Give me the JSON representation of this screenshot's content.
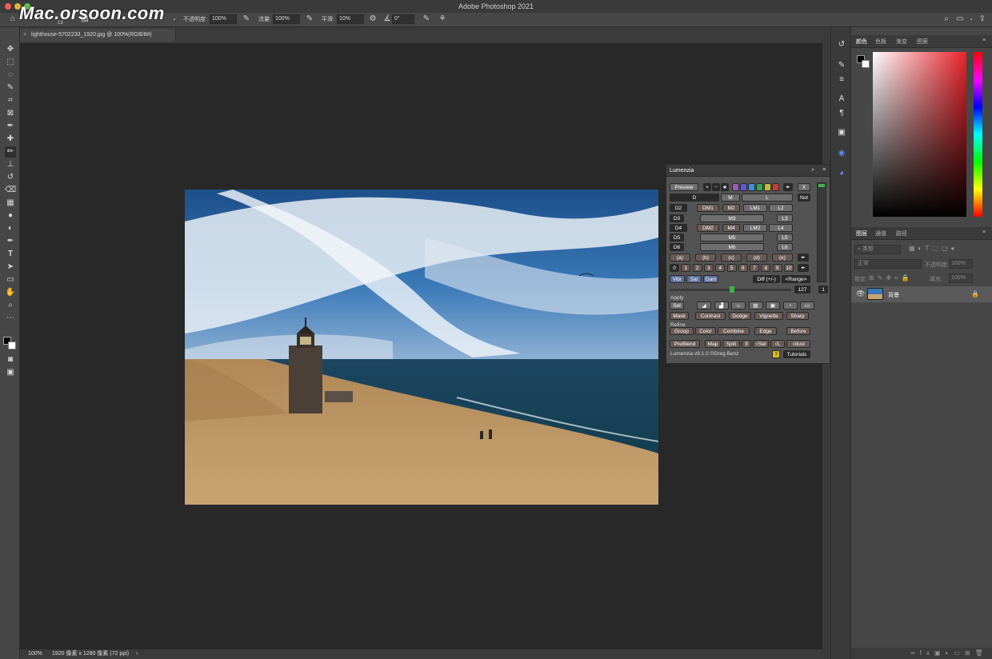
{
  "app": {
    "title": "Adobe Photoshop 2021",
    "watermark": "Mac.orsoon.com"
  },
  "options_bar": {
    "brush_size": "13",
    "opacity_label": "不透明度:",
    "opacity_value": "100%",
    "flow_label": "流量:",
    "flow_value": "100%",
    "smoothing_label": "平滑:",
    "smoothing_value": "10%",
    "angle_value": "0°"
  },
  "document": {
    "tab_label": "lighthouse-5702233_1920.jpg @ 100%(RGB/8#)",
    "zoom": "100%",
    "info": "1920 像素 x 1280 像素 (72 ppi)"
  },
  "tools": [
    "move",
    "marquee",
    "lasso",
    "quick-select",
    "crop",
    "frame",
    "eyedropper",
    "healing",
    "brush",
    "stamp",
    "history-brush",
    "eraser",
    "gradient",
    "blur",
    "dodge",
    "pen",
    "type",
    "path-select",
    "rectangle",
    "hand",
    "zoom",
    "more"
  ],
  "color_panel": {
    "tabs": [
      "颜色",
      "色板",
      "渐变",
      "图案"
    ],
    "active_tab": "颜色",
    "colors": {
      "foreground": "#000000",
      "background": "#ffffff",
      "picker_hue": "#e8232a"
    }
  },
  "layers_panel": {
    "tabs": [
      "图层",
      "通道",
      "路径"
    ],
    "active_tab": "图层",
    "filter_label": "类型",
    "blend_mode": "正常",
    "opacity_label": "不透明度:",
    "opacity_value": "100%",
    "lock_label": "锁定:",
    "fill_label": "填充:",
    "fill_value": "100%",
    "layers": [
      {
        "name": "背景",
        "visible": true,
        "locked": true
      }
    ]
  },
  "lumenzia": {
    "title": "Lumenzia",
    "preview_label": "Preview",
    "x_label": "X",
    "not_label": "Not",
    "zone_rows": [
      [
        "D",
        "M",
        "L"
      ],
      [
        "D2",
        "DM1",
        "M2",
        "LM1",
        "L2"
      ],
      [
        "D3",
        "M3",
        "L3"
      ],
      [
        "D4",
        "DM2",
        "M4",
        "LM2",
        "L4"
      ],
      [
        "D5",
        "M5",
        "L5"
      ],
      [
        "D6",
        "M6",
        "L6"
      ]
    ],
    "paren_row": [
      "(a)",
      "(b)",
      "(c)",
      "(d)",
      "(e)"
    ],
    "number_row": [
      "0",
      "1",
      "2",
      "3",
      "4",
      "5",
      "6",
      "7",
      "8",
      "9",
      "10"
    ],
    "adjust_row": [
      "Vibr",
      "Sat",
      "Gam"
    ],
    "diff_label": "Diff (+/-)",
    "range_label": "<Range>",
    "range_value": "127",
    "range_side": "1",
    "apply_label": "Apply",
    "sel_label": "Sel",
    "apply_row": [
      "Mask",
      "Contrast",
      "Dodge",
      "Vignette",
      "Sharp"
    ],
    "refine_label": "Refine",
    "refine_row": [
      "Group",
      "Color",
      "Combine",
      "Edge",
      "Before"
    ],
    "bottom_row": [
      "PreBlend",
      "Map",
      "Split",
      "If",
      "√Sel",
      "√L",
      "√dust"
    ],
    "version": "Lumenzia v9.1.0 ©Greg Benz",
    "help_label": "?",
    "tutorials_label": "Tutorials",
    "swatches": [
      "#9b59b6",
      "#5b5bd6",
      "#3a8fd6",
      "#2ea84a",
      "#c9b93a",
      "#cc3b3b"
    ]
  }
}
